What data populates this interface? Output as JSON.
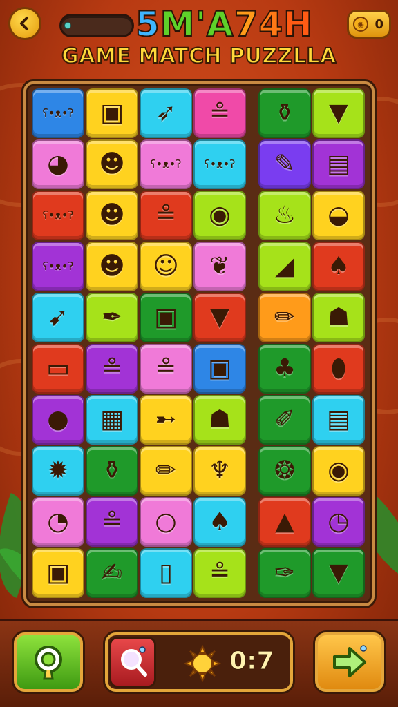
{
  "header": {
    "title_chars": [
      {
        "ch": "5",
        "color": "#3fb6ff"
      },
      {
        "ch": " ",
        "color": "#ffffff"
      },
      {
        "ch": "M",
        "color": "#5ed12a"
      },
      {
        "ch": "'A",
        "color": "#5ed12a"
      },
      {
        "ch": "7",
        "color": "#ff9b1a"
      },
      {
        "ch": "4",
        "color": "#ff7a16"
      },
      {
        "ch": "H",
        "color": "#ff5b14"
      }
    ],
    "subtitle": "GAME MATCH PUZZLLA",
    "coins": "0",
    "back_icon": "chevron-left-icon",
    "coin_icon": "coin-icon"
  },
  "board": {
    "tiles": [
      [
        {
          "bg": "#2e86e6",
          "icon": "bear-face"
        },
        {
          "bg": "#ffd21f",
          "icon": "box"
        },
        {
          "bg": "#2fd0f0",
          "icon": "arrow-pin"
        },
        {
          "bg": "#f04aa8",
          "icon": "cat-face"
        },
        {
          "bg": "#1f9a2a",
          "icon": "jar"
        },
        {
          "bg": "#a6e21a",
          "icon": "fox-face"
        }
      ],
      [
        {
          "bg": "#f07ad8",
          "icon": "dog-face"
        },
        {
          "bg": "#ffd21f",
          "icon": "monster-face"
        },
        {
          "bg": "#f07ad8",
          "icon": "bear-face"
        },
        {
          "bg": "#2fd0f0",
          "icon": "bear-face"
        },
        {
          "bg": "#7a3df0",
          "icon": "brush"
        },
        {
          "bg": "#a233d6",
          "icon": "gift-box"
        }
      ],
      [
        {
          "bg": "#e03a1e",
          "icon": "bear-face"
        },
        {
          "bg": "#ffd21f",
          "icon": "monster-face"
        },
        {
          "bg": "#e03a1e",
          "icon": "cat-face"
        },
        {
          "bg": "#a6e21a",
          "icon": "pig-face"
        },
        {
          "bg": "#a6e21a",
          "icon": "hair-dryer"
        },
        {
          "bg": "#ffd21f",
          "icon": "spoon"
        }
      ],
      [
        {
          "bg": "#a233d6",
          "icon": "bear-face"
        },
        {
          "bg": "#ffd21f",
          "icon": "monster-face"
        },
        {
          "bg": "#ffd21f",
          "icon": "alien-face"
        },
        {
          "bg": "#f07ad8",
          "icon": "leaf"
        },
        {
          "bg": "#a6e21a",
          "icon": "shoe"
        },
        {
          "bg": "#e03a1e",
          "icon": "flame"
        }
      ],
      [
        {
          "bg": "#2fd0f0",
          "icon": "rocket"
        },
        {
          "bg": "#a6e21a",
          "icon": "syringe"
        },
        {
          "bg": "#1f9a2a",
          "icon": "box"
        },
        {
          "bg": "#e03a1e",
          "icon": "fox-face"
        },
        {
          "bg": "#ff9b1a",
          "icon": "pencil"
        },
        {
          "bg": "#a6e21a",
          "icon": "turtle"
        }
      ],
      [
        {
          "bg": "#e03a1e",
          "icon": "book"
        },
        {
          "bg": "#a233d6",
          "icon": "cat-face"
        },
        {
          "bg": "#f07ad8",
          "icon": "cat-face"
        },
        {
          "bg": "#2e86e6",
          "icon": "box"
        },
        {
          "bg": "#1f9a2a",
          "icon": "pear"
        },
        {
          "bg": "#e03a1e",
          "icon": "egg"
        }
      ],
      [
        {
          "bg": "#a233d6",
          "icon": "balloon"
        },
        {
          "bg": "#2fd0f0",
          "icon": "can"
        },
        {
          "bg": "#ffd21f",
          "icon": "pepper"
        },
        {
          "bg": "#a6e21a",
          "icon": "turtle"
        },
        {
          "bg": "#1f9a2a",
          "icon": "crayon"
        },
        {
          "bg": "#2fd0f0",
          "icon": "gift-box"
        }
      ],
      [
        {
          "bg": "#2fd0f0",
          "icon": "cookie"
        },
        {
          "bg": "#1f9a2a",
          "icon": "jar"
        },
        {
          "bg": "#ffd21f",
          "icon": "pencil"
        },
        {
          "bg": "#ffd21f",
          "icon": "ice-cream"
        },
        {
          "bg": "#1f9a2a",
          "icon": "bird"
        },
        {
          "bg": "#ffd21f",
          "icon": "pig-face"
        }
      ],
      [
        {
          "bg": "#f07ad8",
          "icon": "monkey-face"
        },
        {
          "bg": "#a233d6",
          "icon": "cat-face"
        },
        {
          "bg": "#f07ad8",
          "icon": "bun"
        },
        {
          "bg": "#2fd0f0",
          "icon": "flame"
        },
        {
          "bg": "#e03a1e",
          "icon": "cake"
        },
        {
          "bg": "#a233d6",
          "icon": "clock"
        }
      ],
      [
        {
          "bg": "#ffd21f",
          "icon": "box"
        },
        {
          "bg": "#1f9a2a",
          "icon": "paintbrush"
        },
        {
          "bg": "#2fd0f0",
          "icon": "phone"
        },
        {
          "bg": "#a6e21a",
          "icon": "cat-face"
        },
        {
          "bg": "#1f9a2a",
          "icon": "marker"
        },
        {
          "bg": "#1f9a2a",
          "icon": "fox-face"
        }
      ]
    ]
  },
  "footer": {
    "score": "0:7",
    "hint_icon": "magnifier-badge-icon",
    "magnify_icon": "magnifier-icon",
    "sun_icon": "sun-icon",
    "next_icon": "arrow-right-icon"
  }
}
